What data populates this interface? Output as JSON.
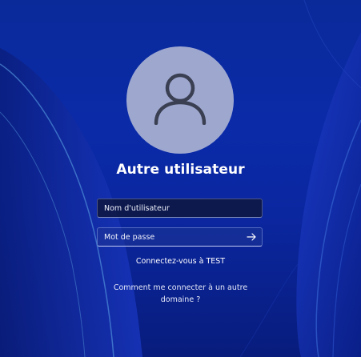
{
  "login": {
    "user_name": "Autre utilisateur",
    "username_placeholder": "Nom d'utilisateur",
    "password_placeholder": "Mot de passe",
    "sign_in_to": "Connectez-vous à TEST",
    "other_domain_link": "Comment me connecter à un autre domaine ?"
  },
  "icons": {
    "avatar": "user-silhouette-icon",
    "submit": "arrow-right-icon"
  },
  "colors": {
    "background": "#0a2aa8",
    "avatar_circle": "#9ea8cf",
    "avatar_glyph": "#3a3f52",
    "text": "#ffffff"
  }
}
